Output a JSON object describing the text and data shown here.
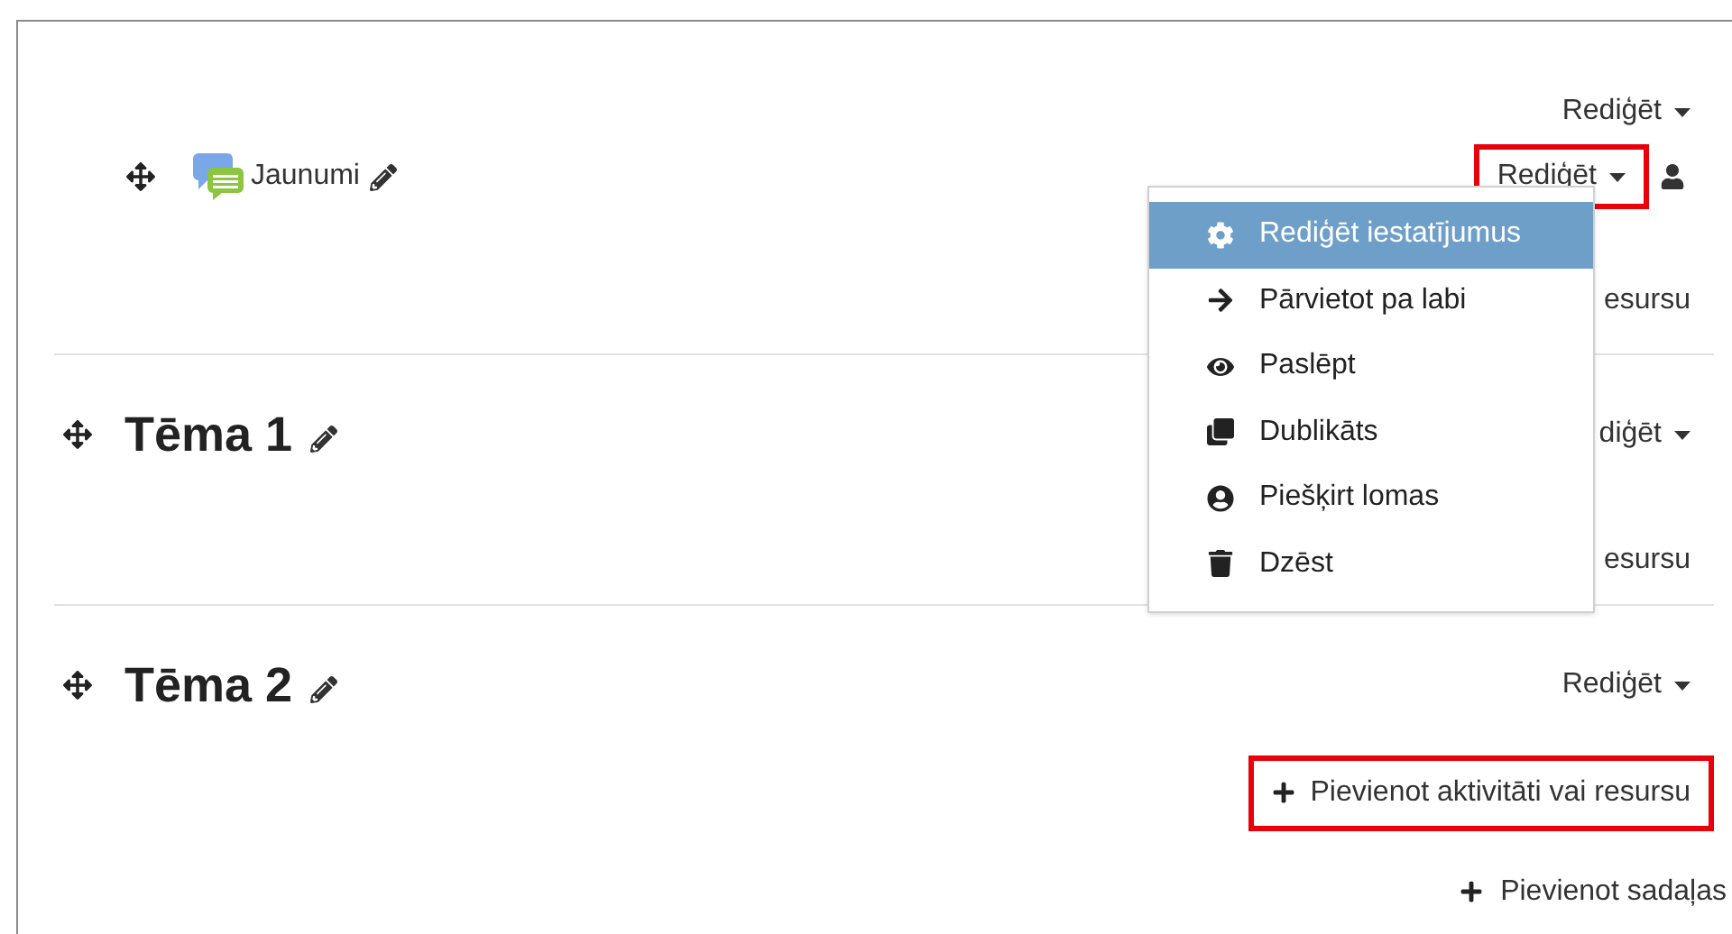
{
  "sections": [
    {
      "kind": "general",
      "edit_menu": {
        "label": "Rediģēt",
        "highlighted": false
      },
      "activities": [
        {
          "name": "Jaunumi",
          "edit_menu": {
            "label": "Rediģēt",
            "highlighted": true
          }
        }
      ],
      "add_activity": {
        "label": "esursu",
        "show_icon": false,
        "highlighted": false
      }
    },
    {
      "kind": "topic",
      "title": "Tēma 1",
      "edit_menu": {
        "label": "diģēt",
        "highlighted": false
      },
      "add_activity": {
        "label": "esursu",
        "show_icon": false,
        "highlighted": false
      }
    },
    {
      "kind": "topic",
      "title": "Tēma 2",
      "edit_menu": {
        "label": "Rediģēt",
        "highlighted": false
      },
      "add_activity": {
        "label": "Pievienot aktivitāti vai resursu",
        "show_icon": true,
        "highlighted": true
      }
    }
  ],
  "dropdown": {
    "items": [
      {
        "kind": "settings",
        "label": "Rediģēt iestatījumus",
        "selected": true
      },
      {
        "kind": "move",
        "label": "Pārvietot pa labi",
        "selected": false
      },
      {
        "kind": "hide",
        "label": "Paslēpt",
        "selected": false
      },
      {
        "kind": "duplicate",
        "label": "Dublikāts",
        "selected": false
      },
      {
        "kind": "roles",
        "label": "Piešķirt lomas",
        "selected": false
      },
      {
        "kind": "delete",
        "label": "Dzēst",
        "selected": false
      }
    ]
  },
  "add_section": {
    "label": "Pievienot sadaļas"
  }
}
